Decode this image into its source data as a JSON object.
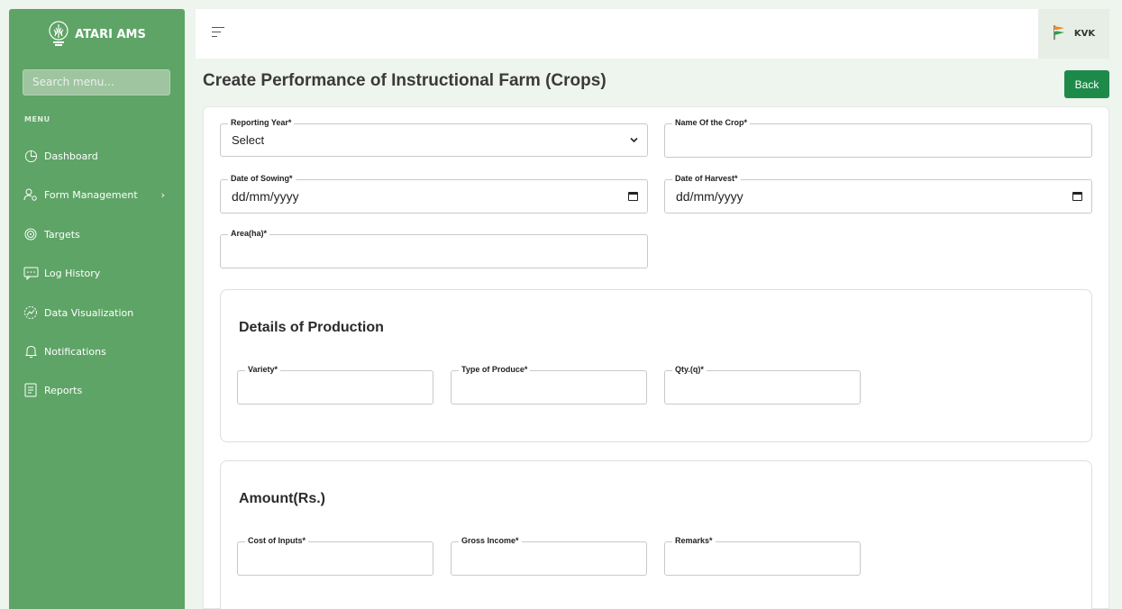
{
  "sidebar": {
    "brand": "ATARI AMS",
    "search_placeholder": "Search menu...",
    "menu_label": "MENU",
    "items": [
      {
        "label": "Dashboard",
        "icon": "pie-chart-icon"
      },
      {
        "label": "Form Management",
        "icon": "users-gear-icon",
        "has_children": true
      },
      {
        "label": "Targets",
        "icon": "target-icon"
      },
      {
        "label": "Log History",
        "icon": "message-icon"
      },
      {
        "label": "Data Visualization",
        "icon": "chart-icon"
      },
      {
        "label": "Notifications",
        "icon": "bell-icon"
      },
      {
        "label": "Reports",
        "icon": "report-icon"
      }
    ]
  },
  "topbar": {
    "user_label": "KVK"
  },
  "page": {
    "title": "Create Performance of Instructional Farm (Crops)",
    "back_label": "Back"
  },
  "form": {
    "reporting_year": {
      "label": "Reporting Year*",
      "value": "Select"
    },
    "crop_name": {
      "label": "Name Of the Crop*",
      "value": ""
    },
    "date_sowing": {
      "label": "Date of Sowing*",
      "value": "dd/mm/yyyy"
    },
    "date_harvest": {
      "label": "Date of Harvest*",
      "value": "dd/mm/yyyy"
    },
    "area": {
      "label": "Area(ha)*",
      "value": ""
    }
  },
  "production": {
    "title": "Details of Production",
    "variety": {
      "label": "Variety*"
    },
    "produce_type": {
      "label": "Type of Produce*"
    },
    "qty": {
      "label": "Qty.(q)*"
    }
  },
  "amount": {
    "title": "Amount(Rs.)",
    "cost_inputs": {
      "label": "Cost of Inputs*"
    },
    "gross_income": {
      "label": "Gross Income*"
    },
    "remarks": {
      "label": "Remarks*"
    }
  },
  "colors": {
    "sidebar": "#5ea466",
    "accent": "#1e8a4a",
    "background": "#eef4ee"
  }
}
